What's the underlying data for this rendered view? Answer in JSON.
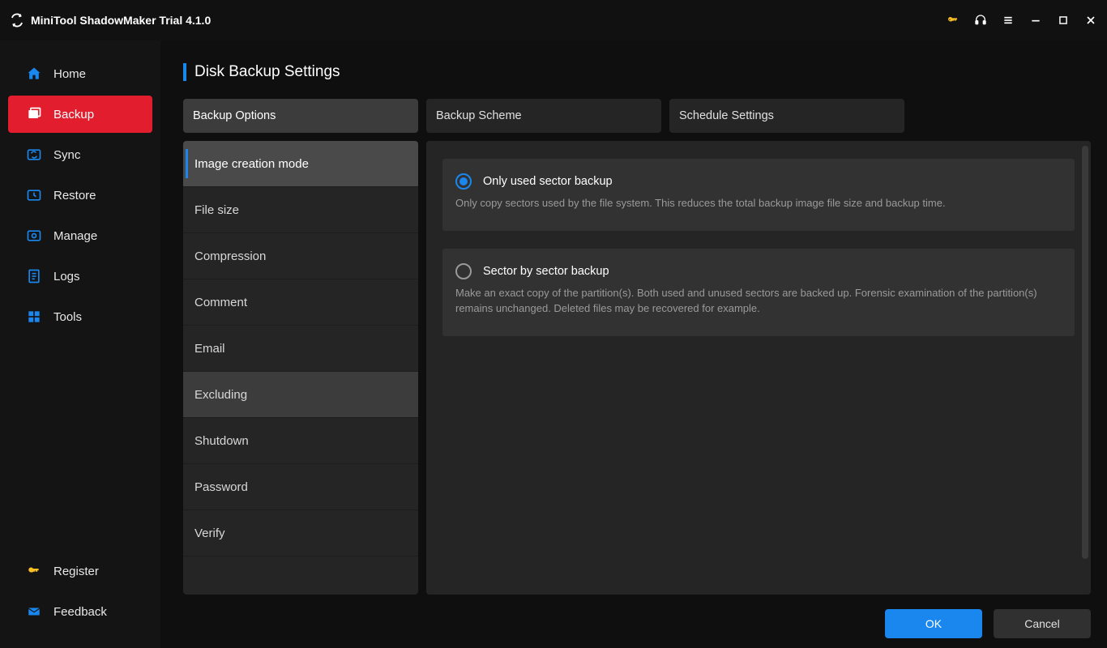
{
  "titlebar": {
    "title": "MiniTool ShadowMaker Trial 4.1.0"
  },
  "sidebar": {
    "items": [
      {
        "label": "Home"
      },
      {
        "label": "Backup"
      },
      {
        "label": "Sync"
      },
      {
        "label": "Restore"
      },
      {
        "label": "Manage"
      },
      {
        "label": "Logs"
      },
      {
        "label": "Tools"
      }
    ],
    "footer": [
      {
        "label": "Register"
      },
      {
        "label": "Feedback"
      }
    ]
  },
  "page": {
    "title": "Disk Backup Settings"
  },
  "tabs": [
    {
      "label": "Backup Options"
    },
    {
      "label": "Backup Scheme"
    },
    {
      "label": "Schedule Settings"
    }
  ],
  "options": [
    {
      "label": "Image creation mode"
    },
    {
      "label": "File size"
    },
    {
      "label": "Compression"
    },
    {
      "label": "Comment"
    },
    {
      "label": "Email"
    },
    {
      "label": "Excluding"
    },
    {
      "label": "Shutdown"
    },
    {
      "label": "Password"
    },
    {
      "label": "Verify"
    }
  ],
  "radios": [
    {
      "title": "Only used sector backup",
      "desc": "Only copy sectors used by the file system. This reduces the total backup image file size and backup time."
    },
    {
      "title": "Sector by sector backup",
      "desc": "Make an exact copy of the partition(s). Both used and unused sectors are backed up. Forensic examination of the partition(s) remains unchanged. Deleted files may be recovered for example."
    }
  ],
  "buttons": {
    "ok": "OK",
    "cancel": "Cancel"
  }
}
